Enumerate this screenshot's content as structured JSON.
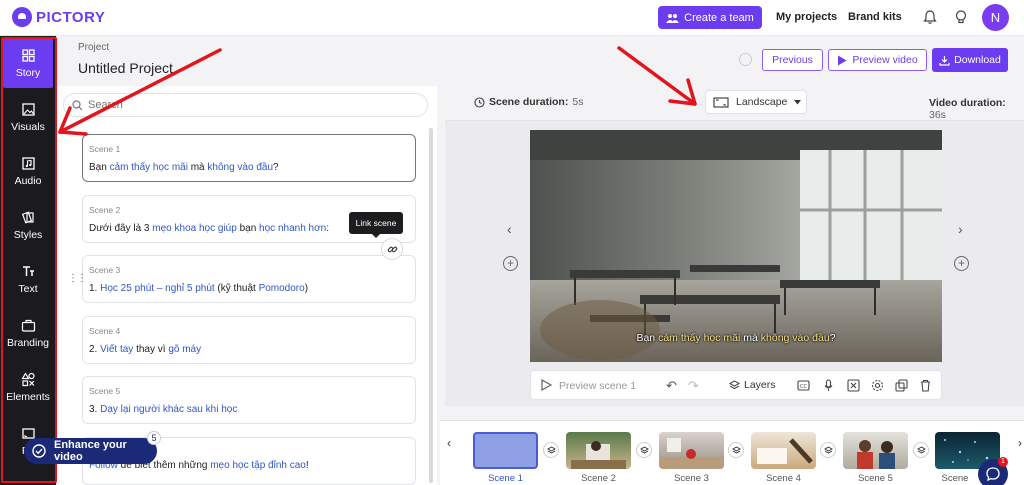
{
  "app": {
    "brand": "PICTORY"
  },
  "top": {
    "create_team": "Create a team",
    "my_projects": "My projects",
    "brand_kits": "Brand kits",
    "avatar_initial": "N"
  },
  "nav": {
    "items": [
      {
        "label": "Story",
        "icon": "story-icon"
      },
      {
        "label": "Visuals",
        "icon": "image-icon"
      },
      {
        "label": "Audio",
        "icon": "music-icon"
      },
      {
        "label": "Styles",
        "icon": "styles-icon"
      },
      {
        "label": "Text",
        "icon": "text-icon"
      },
      {
        "label": "Branding",
        "icon": "briefcase-icon"
      },
      {
        "label": "Elements",
        "icon": "shapes-icon"
      },
      {
        "label": "Fo",
        "icon": "format-icon"
      }
    ]
  },
  "project": {
    "label": "Project",
    "title": "Untitled Project"
  },
  "search": {
    "placeholder": "Search"
  },
  "scenes": [
    {
      "label": "Scene 1",
      "parts": [
        "Bạn ",
        "cảm thấy học mãi",
        " mà ",
        "không vào đầu",
        "?"
      ]
    },
    {
      "label": "Scene 2",
      "parts": [
        "Dưới đây là 3 ",
        "mẹo khoa học giúp",
        " bạn ",
        "học nhanh hơn",
        ":"
      ]
    },
    {
      "label": "Scene 3",
      "parts": [
        "1. ",
        "Học 25 phút – nghỉ 5 phút",
        " (kỹ thuật ",
        "Pomodoro",
        ")"
      ]
    },
    {
      "label": "Scene 4",
      "parts": [
        "2. ",
        "Viết tay",
        " thay vì ",
        "gõ máy",
        ""
      ]
    },
    {
      "label": "Scene 5",
      "parts": [
        "3. ",
        "Dạy lại người khác sau khi học",
        "",
        "",
        ""
      ]
    },
    {
      "label": "",
      "parts": [
        "",
        "Follow",
        " để biết thêm những ",
        "mẹo học tập đỉnh cao",
        "!"
      ]
    }
  ],
  "tooltip": "Link scene",
  "enhance": {
    "label": "Enhance your video",
    "badge": "5"
  },
  "preview": {
    "scene_duration_label": "Scene duration:",
    "scene_duration_value": "5s",
    "orientation": "Landscape",
    "video_duration_label": "Video duration:",
    "video_duration_value": "36s",
    "previous": "Previous",
    "preview_video": "Preview video",
    "download": "Download",
    "subtitle_parts": [
      "Bạn ",
      "cảm thấy học mãi",
      " mà ",
      "không vào đầu",
      "?"
    ],
    "preview_scene": "Preview scene 1",
    "layers": "Layers"
  },
  "timeline": {
    "scenes": [
      "Scene 1",
      "Scene 2",
      "Scene 3",
      "Scene 4",
      "Scene 5",
      "Scene"
    ]
  },
  "chat_badge": "1",
  "colors": {
    "accent": "#6b3cf0",
    "annotation": "#e2141d",
    "keyword": "#3157c9"
  }
}
